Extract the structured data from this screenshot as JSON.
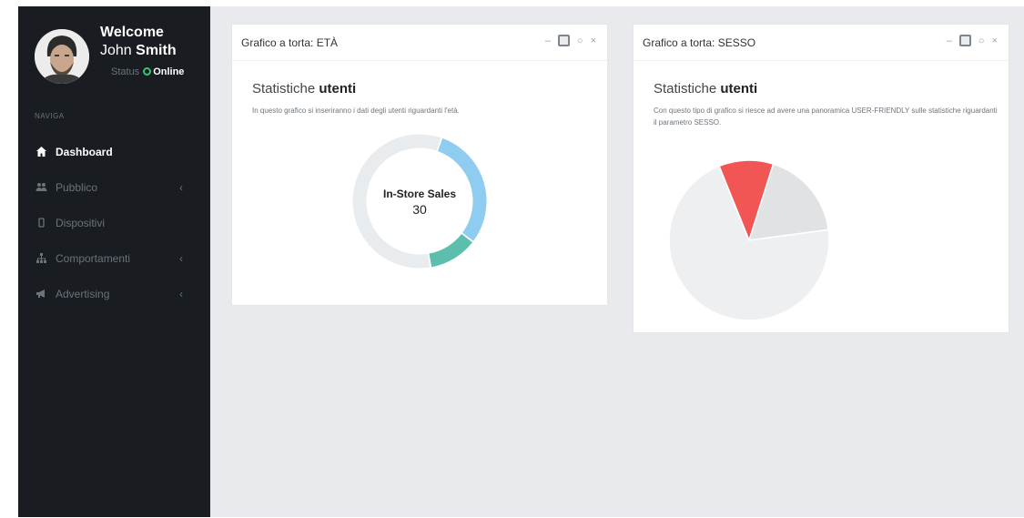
{
  "sidebar": {
    "welcome": "Welcome",
    "user_first": "John",
    "user_last": "Smith",
    "status_label": "Status",
    "status_value": "Online",
    "nav_header": "NAVIGA",
    "items": [
      {
        "label": "Dashboard",
        "icon": "home-icon",
        "has_chevron": false,
        "active": true
      },
      {
        "label": "Pubblico",
        "icon": "users-icon",
        "has_chevron": true,
        "active": false
      },
      {
        "label": "Dispositivi",
        "icon": "mobile-icon",
        "has_chevron": false,
        "active": false
      },
      {
        "label": "Comportamenti",
        "icon": "sitemap-icon",
        "has_chevron": true,
        "active": false
      },
      {
        "label": "Advertising",
        "icon": "bullhorn-icon",
        "has_chevron": true,
        "active": false
      }
    ],
    "chevron": "‹"
  },
  "panel_eta": {
    "title": "Grafico a torta: ETÀ",
    "subtitle_prefix": "Statistiche",
    "subtitle_bold": "utenti",
    "description": "In questo grafico si inseriranno i dati degli utenti riguardanti l'età.",
    "center_label": "In-Store Sales",
    "center_value": "30",
    "tools": {
      "minimize": "–",
      "collapse": "○",
      "close": "×"
    }
  },
  "panel_sesso": {
    "title": "Grafico a torta: SESSO",
    "subtitle_prefix": "Statistiche",
    "subtitle_bold": "utenti",
    "description": "Con questo tipo di grafico si riesce ad avere una panoramica USER-FRIENDLY sulle statistiche riguardanti il parametro SESSO.",
    "tools": {
      "minimize": "–",
      "collapse": "○",
      "close": "×"
    }
  },
  "colors": {
    "sidebar_bg": "#191c20",
    "online": "#2ecc71",
    "donut_blue": "#8ecdf0",
    "donut_teal": "#5cbfad",
    "donut_grey": "#e9ecef",
    "pie_red": "#f25654",
    "pie_grey": "#e0e2e4",
    "pie_light": "#eeeff1"
  },
  "chart_data": [
    {
      "type": "pie",
      "variant": "donut",
      "slices": [
        {
          "color": "#8ecdf0",
          "value": 30
        },
        {
          "color": "#5cbfad",
          "value": 12
        },
        {
          "color": "#e9ecef",
          "value": 58
        }
      ]
    },
    {
      "type": "pie",
      "slices": [
        {
          "color": "#f25654",
          "value": 11
        },
        {
          "color": "#e0e2e4",
          "value": 18
        },
        {
          "color": "#eeeff1",
          "value": 71
        }
      ]
    }
  ]
}
